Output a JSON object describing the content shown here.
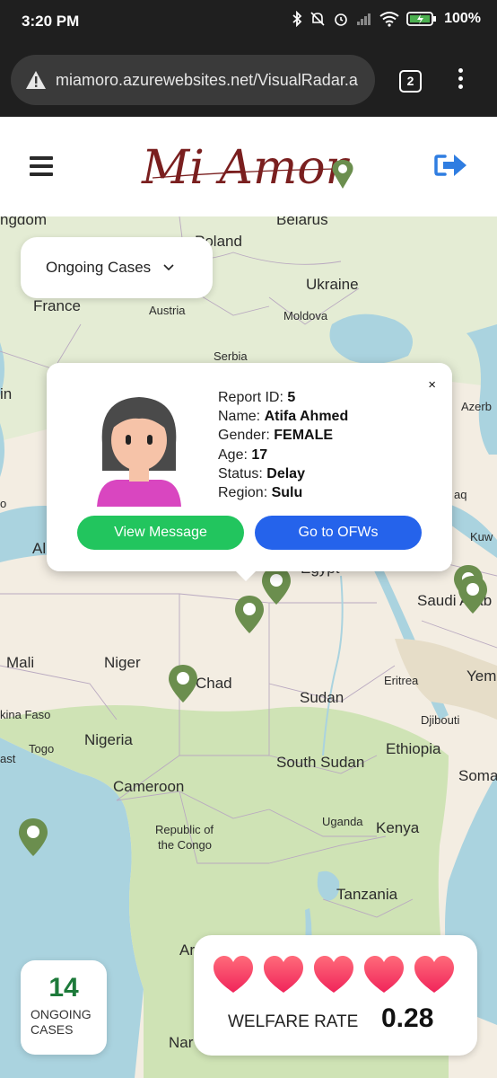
{
  "status_bar": {
    "time": "3:20 PM",
    "battery": "100%"
  },
  "browser": {
    "url": "miamoro.azurewebsites.net/VisualRadar.a",
    "tab_count": "2"
  },
  "header": {
    "logo_text": "Mi Amor"
  },
  "filter": {
    "selected": "Ongoing Cases"
  },
  "map_labels": {
    "belarus": "Belarus",
    "poland": "Poland",
    "ukraine": "Ukraine",
    "kingdom": "ngdom",
    "france": "France",
    "austria": "Austria",
    "moldova": "Moldova",
    "serbia": "Serbia",
    "azerb": "Azerb",
    "in": "in",
    "aq": "aq",
    "kuw": "Kuw",
    "al": "Al",
    "o": "o",
    "egypt": "Egypt",
    "saudi": "Saudi Arab",
    "mali": "Mali",
    "niger": "Niger",
    "chad": "Chad",
    "sudan": "Sudan",
    "eritrea": "Eritrea",
    "yem": "Yem",
    "burkina": "kina Faso",
    "djibouti": "Djibouti",
    "togo": "Togo",
    "nigeria": "Nigeria",
    "ethiopia": "Ethiopia",
    "ast": "ast",
    "south_sudan": "South Sudan",
    "soma": "Soma",
    "cameroon": "Cameroon",
    "uganda": "Uganda",
    "kenya": "Kenya",
    "republic_congo_1": "Republic of",
    "republic_congo_2": "the Congo",
    "tanzania": "Tanzania",
    "ar": "Ar",
    "nar": "Nar"
  },
  "popup": {
    "close": "×",
    "report_id_label": "Report ID:",
    "report_id": "5",
    "name_label": "Name:",
    "name": "Atifa Ahmed",
    "gender_label": "Gender:",
    "gender": "FEMALE",
    "age_label": "Age:",
    "age": "17",
    "status_label": "Status:",
    "status": "Delay",
    "region_label": "Region:",
    "region": "Sulu",
    "view_message": "View Message",
    "go_to_ofws": "Go to OFWs"
  },
  "cases": {
    "count": "14",
    "label_line1": "ONGOING",
    "label_line2": "CASES"
  },
  "welfare": {
    "label": "WELFARE RATE",
    "value": "0.28",
    "hearts": 5
  },
  "colors": {
    "pin": "#6b8e4e",
    "map_land": "#f3ede2",
    "map_water": "#aad3df",
    "map_green": "#cfe3b5",
    "view_message": "#22c55e",
    "go_to_ofws": "#2563eb",
    "cases_number": "#1d7a3a",
    "logo": "#7a1f1f",
    "logout": "#2f7de1"
  },
  "icons": [
    "warning-icon",
    "menu-dots-icon",
    "hamburger-icon",
    "logout-icon",
    "chevron-down-icon",
    "map-pin-icon",
    "heart-icon",
    "avatar-girl-icon"
  ]
}
